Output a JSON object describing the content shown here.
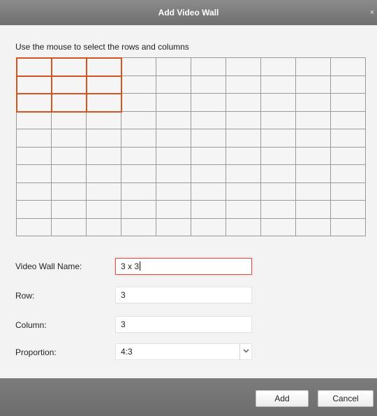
{
  "dialog": {
    "title": "Add Video Wall",
    "close_glyph": "×"
  },
  "instruction": "Use the mouse to select the rows and columns",
  "grid": {
    "total_rows": 10,
    "total_columns": 10,
    "selected_rows": 3,
    "selected_columns": 3,
    "selection_color": "#d2551f"
  },
  "form": {
    "name_label": "Video Wall Name:",
    "name_value": "3 x 3",
    "row_label": "Row:",
    "row_value": "3",
    "column_label": "Column:",
    "column_value": "3",
    "proportion_label": "Proportion:",
    "proportion_value": "4:3",
    "proportion_icon": "chevron-down-icon"
  },
  "buttons": {
    "add": "Add",
    "cancel": "Cancel"
  }
}
